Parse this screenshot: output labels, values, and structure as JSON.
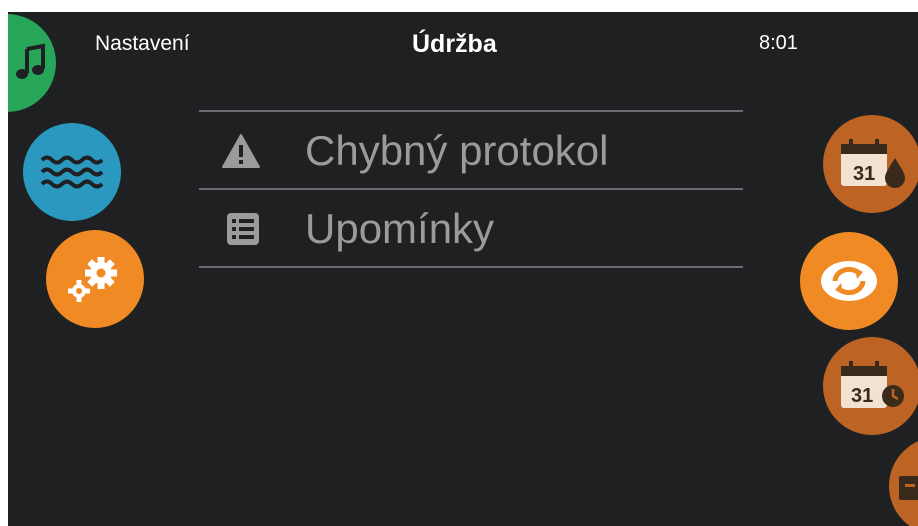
{
  "header": {
    "left_label": "Nastavení",
    "title": "Údržba",
    "time": "8:01"
  },
  "menu": {
    "items": [
      {
        "label": "Chybný protokol",
        "icon": "warning-icon"
      },
      {
        "label": "Upomínky",
        "icon": "list-icon"
      }
    ]
  },
  "side_nav": {
    "left": [
      {
        "name": "music",
        "icon": "music-note-icon",
        "color": "#27a65a"
      },
      {
        "name": "water",
        "icon": "water-waves-icon",
        "color": "#2b98bf"
      },
      {
        "name": "settings",
        "icon": "gears-icon",
        "color": "#f08a25",
        "active": true
      }
    ],
    "right": [
      {
        "name": "calendar-water",
        "icon": "calendar-drop-icon",
        "color": "#bd6425",
        "day": "31"
      },
      {
        "name": "refresh",
        "icon": "refresh-icon",
        "color": "#f08a25",
        "active": true
      },
      {
        "name": "calendar-clock",
        "icon": "calendar-clock-icon",
        "color": "#bd6425",
        "day": "31"
      },
      {
        "name": "extra",
        "icon": "partial-icon",
        "color": "#bd6425"
      }
    ]
  },
  "colors": {
    "background": "#1f2022",
    "text": "#ffffff",
    "menu_text": "#9a9b9d",
    "divider": "#6b6d70"
  }
}
